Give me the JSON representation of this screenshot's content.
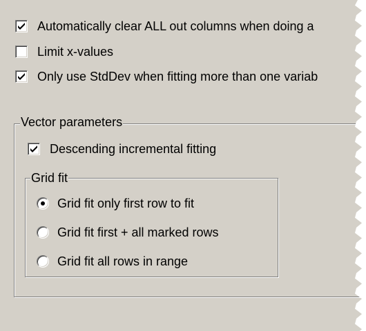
{
  "options": {
    "auto_clear": {
      "label": "Automatically clear ALL out columns when doing a",
      "checked": true
    },
    "limit_x": {
      "label": "Limit x-values",
      "checked": false
    },
    "stddev": {
      "label": "Only use StdDev when fitting more than one variab",
      "checked": true
    }
  },
  "vector_parameters": {
    "title": "Vector parameters",
    "descending": {
      "label": "Descending incremental fitting",
      "checked": true
    },
    "grid_fit": {
      "title": "Grid fit",
      "selected_index": 0,
      "options": [
        "Grid fit only first row to fit",
        "Grid fit first + all marked rows",
        "Grid fit all rows in range"
      ]
    }
  },
  "colors": {
    "face": "#d4d0c8",
    "shadow": "#808080",
    "highlight": "#ffffff"
  }
}
